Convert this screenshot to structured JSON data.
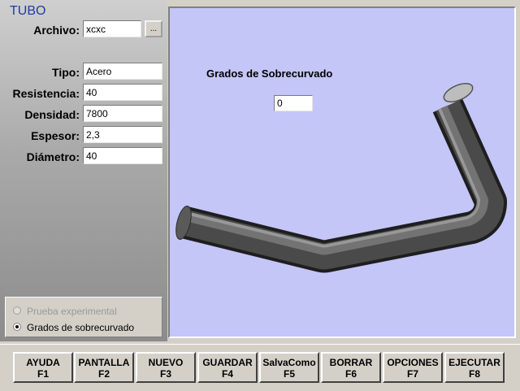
{
  "app": {
    "title": "TUBO"
  },
  "form": {
    "archivo": {
      "label": "Archivo:",
      "value": "xcxc",
      "browse_label": "..."
    },
    "fields": [
      {
        "label": "Tipo:",
        "value": "Acero"
      },
      {
        "label": "Resistencia:",
        "value": "40"
      },
      {
        "label": "Densidad:",
        "value": "7800"
      },
      {
        "label": "Espesor:",
        "value": "2,3"
      },
      {
        "label": "Diámetro:",
        "value": "40"
      }
    ]
  },
  "mode": {
    "options": [
      {
        "label": "Prueba experimental",
        "selected": false,
        "enabled": false
      },
      {
        "label": "Grados de sobrecurvado",
        "selected": true,
        "enabled": true
      }
    ]
  },
  "viewport": {
    "background": "#c4c6f7",
    "overcurve_label": "Grados de Sobrecurvado",
    "overcurve_value": "0",
    "model": "bent-tube-3d"
  },
  "fkeys": [
    {
      "label": "AYUDA",
      "key": "F1"
    },
    {
      "label": "PANTALLA",
      "key": "F2"
    },
    {
      "label": "NUEVO",
      "key": "F3"
    },
    {
      "label": "GUARDAR",
      "key": "F4"
    },
    {
      "label": "SalvaComo",
      "key": "F5"
    },
    {
      "label": "BORRAR",
      "key": "F6"
    },
    {
      "label": "OPCIONES",
      "key": "F7"
    },
    {
      "label": "EJECUTAR",
      "key": "F8"
    }
  ]
}
